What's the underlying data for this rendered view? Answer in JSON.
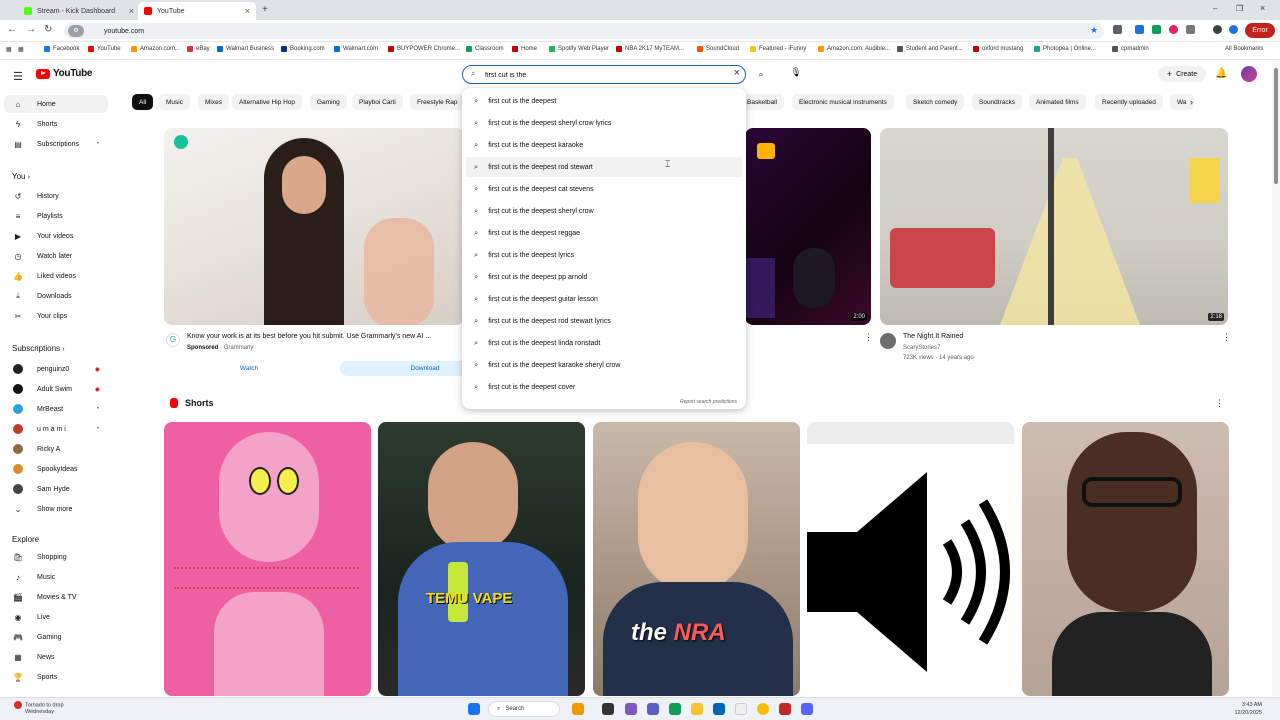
{
  "browser": {
    "tabs": [
      {
        "title": "Stream - Kick Dashboard",
        "color": "#53fc18"
      },
      {
        "title": "YouTube",
        "color": "#ff0000"
      }
    ],
    "url": "youtube.com",
    "error_button": "Error",
    "bookmarks": [
      {
        "label": "Facebook",
        "color": "#1877f2"
      },
      {
        "label": "YouTube",
        "color": "#ff0000"
      },
      {
        "label": "Amazon.com...",
        "color": "#f90"
      },
      {
        "label": "eBay",
        "color": "#e53238"
      },
      {
        "label": "Walmart Business",
        "color": "#0071ce"
      },
      {
        "label": "Booking.com",
        "color": "#003580"
      },
      {
        "label": "Walmart.com",
        "color": "#0071ce"
      },
      {
        "label": "BUYPOWER Chrome...",
        "color": "#c00"
      },
      {
        "label": "Classroom",
        "color": "#0f9d58"
      },
      {
        "label": "Home",
        "color": "#c00"
      },
      {
        "label": "Spotify Web Player",
        "color": "#1db954"
      },
      {
        "label": "NBA 2K17 MyTEAM...",
        "color": "#c00"
      },
      {
        "label": "SoundCloud",
        "color": "#f50"
      },
      {
        "label": "Featured - iFunny",
        "color": "#f5c518"
      },
      {
        "label": "Amazon.com: Audible...",
        "color": "#f90"
      },
      {
        "label": "Student and Parent...",
        "color": "#555"
      },
      {
        "label": "oxford mustang",
        "color": "#c00"
      },
      {
        "label": "Photopea | Online...",
        "color": "#18a497"
      },
      {
        "label": "cpmadmin",
        "color": "#555"
      }
    ],
    "all_bookmarks": "All Bookmarks"
  },
  "header": {
    "logo_text": "YouTube",
    "search_value": "first cut is the",
    "create_label": "Create"
  },
  "suggestions": [
    "first cut is the deepest",
    "first cut is the deepest sheryl crow lyrics",
    "first cut is the deepest karaoke",
    "first cut is the deepest rod stewart",
    "first cut is the deepest cat stevens",
    "first cut is the deepest sheryl crow",
    "first cut is the deepest reggae",
    "first cut is the deepest lyrics",
    "first cut is the deepest pp arnold",
    "first cut is the deepest guitar lesson",
    "first cut is the deepest rod stewart lyrics",
    "first cut is the deepest linda ronstadt",
    "first cut is the deepest karaoke sheryl crow",
    "first cut is the deepest cover"
  ],
  "suggestion_prefix": "first cut is the",
  "report_label": "Report search predictions",
  "sidebar": {
    "main": [
      {
        "label": "Home",
        "icon": "home-icon",
        "glyph": "⌂"
      },
      {
        "label": "Shorts",
        "icon": "shorts-icon",
        "glyph": "ϟ"
      },
      {
        "label": "Subscriptions",
        "icon": "subscriptions-icon",
        "glyph": "▤"
      }
    ],
    "you_heading": "You",
    "you": [
      {
        "label": "History",
        "glyph": "↺"
      },
      {
        "label": "Playlists",
        "glyph": "≡"
      },
      {
        "label": "Your videos",
        "glyph": "▶"
      },
      {
        "label": "Watch later",
        "glyph": "◷"
      },
      {
        "label": "Liked videos",
        "glyph": "👍"
      },
      {
        "label": "Downloads",
        "glyph": "⤓"
      },
      {
        "label": "Your clips",
        "glyph": "✂"
      }
    ],
    "subs_heading": "Subscriptions",
    "subs": [
      {
        "label": "penguinz0",
        "color": "#222",
        "badge": "live"
      },
      {
        "label": "Adult Swim",
        "color": "#111",
        "badge": "live"
      },
      {
        "label": "MrBeast",
        "color": "#2aa4d6",
        "badge": "dot"
      },
      {
        "label": "u m a m i",
        "color": "#c0392b",
        "badge": "dot"
      },
      {
        "label": "Ricky A",
        "color": "#8e6b3e",
        "badge": ""
      },
      {
        "label": "SpookyIdeas",
        "color": "#d98b2b",
        "badge": ""
      },
      {
        "label": "Sam Hyde",
        "color": "#444",
        "badge": ""
      }
    ],
    "show_more": "Show more",
    "explore_heading": "Explore",
    "explore": [
      {
        "label": "Shopping",
        "glyph": "🛍"
      },
      {
        "label": "Music",
        "glyph": "♪"
      },
      {
        "label": "Movies & TV",
        "glyph": "🎬"
      },
      {
        "label": "Live",
        "glyph": "◉"
      },
      {
        "label": "Gaming",
        "glyph": "🎮"
      },
      {
        "label": "News",
        "glyph": "▦"
      },
      {
        "label": "Sports",
        "glyph": "🏆"
      }
    ]
  },
  "chips": [
    "All",
    "Music",
    "Mixes",
    "Alternative Hip Hop",
    "Gaming",
    "Playboi Carti",
    "Freestyle Rap",
    "Basketball",
    "Electronic musical instruments",
    "Sketch comedy",
    "Soundtracks",
    "Animated films",
    "Recently uploaded",
    "Wa"
  ],
  "ad": {
    "title": "Know your work is at its best before you hit submit. Use Grammarly's new AI ...",
    "sponsored": "Sponsored",
    "advertiser": "Grammarly",
    "watch": "Watch",
    "download": "Download"
  },
  "videos": [
    {
      "duration": "2:00"
    },
    {
      "title": "The Night It Rained",
      "channel": "ScaryStories7",
      "meta": "723K views · 14 years ago",
      "duration": "2:18"
    }
  ],
  "shorts": {
    "heading": "Shorts",
    "items": [
      {
        "overlay": ""
      },
      {
        "overlay": "TEMU VAPE"
      },
      {
        "overlay_a": "the ",
        "overlay_b": "NRA"
      },
      {
        "overlay": ""
      },
      {
        "overlay": ""
      }
    ]
  },
  "taskbar": {
    "weather_line1": "Tornado to drop",
    "weather_line2": "Wednesday",
    "search": "Search",
    "time": "3:43 AM",
    "date": "12/20/2025"
  }
}
